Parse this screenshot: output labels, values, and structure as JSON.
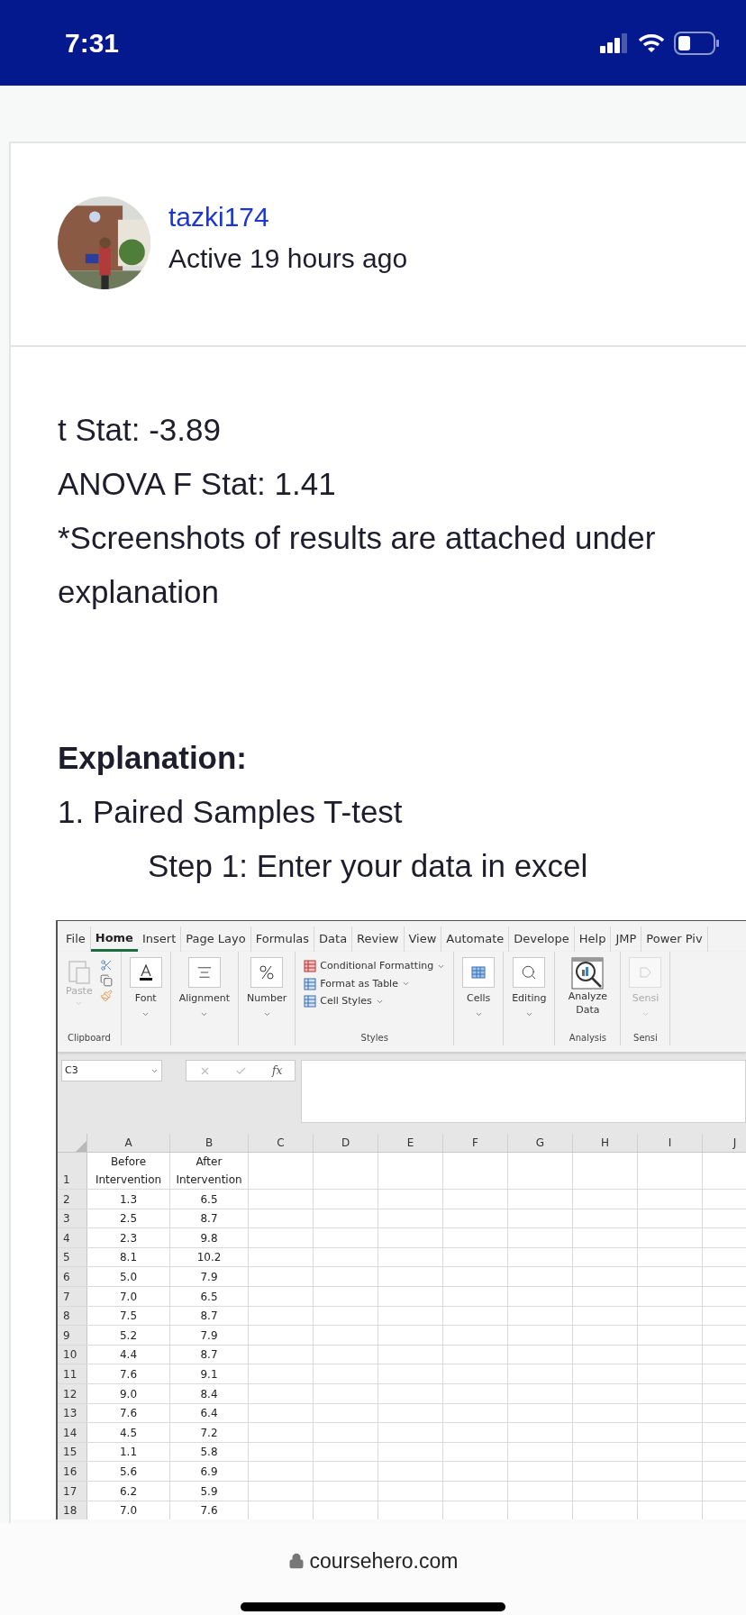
{
  "status_bar": {
    "time": "7:31"
  },
  "author": {
    "username": "tazki174",
    "activity": "Active 19 hours ago"
  },
  "paragraphs": [
    {
      "kind": "plain",
      "text": "t Stat: -3.89"
    },
    {
      "kind": "plain",
      "text": "ANOVA F Stat: 1.41"
    },
    {
      "kind": "plain",
      "text": "*Screenshots of results are attached under explanation"
    },
    {
      "kind": "heading",
      "text": "Explanation:"
    },
    {
      "kind": "plain",
      "text": "1. Paired Samples T-test"
    },
    {
      "kind": "indented",
      "text": "Step 1: Enter your data in excel"
    }
  ],
  "spreadsheet": {
    "tabs": [
      {
        "label": "File",
        "selected": false
      },
      {
        "label": "Home",
        "selected": true
      },
      {
        "label": "Insert",
        "selected": false
      },
      {
        "label": "Page Layo",
        "selected": false
      },
      {
        "label": "Formulas",
        "selected": false
      },
      {
        "label": "Data",
        "selected": false
      },
      {
        "label": "Review",
        "selected": false
      },
      {
        "label": "View",
        "selected": false
      },
      {
        "label": "Automate",
        "selected": false
      },
      {
        "label": "Develope",
        "selected": false
      },
      {
        "label": "Help",
        "selected": false
      },
      {
        "label": "JMP",
        "selected": false
      },
      {
        "label": "Power Piv",
        "selected": false
      }
    ],
    "ribbon": [
      {
        "kind": "clipboard",
        "label": "Paste",
        "disabled": true,
        "footer": "Clipboard"
      },
      {
        "kind": "font",
        "label": "Font"
      },
      {
        "kind": "alignment",
        "label": "Alignment"
      },
      {
        "kind": "number",
        "label": "Number"
      },
      {
        "kind": "styles",
        "items": [
          "Conditional Formatting",
          "Format as Table",
          "Cell Styles"
        ],
        "footer": "Styles"
      },
      {
        "kind": "cells",
        "label": "Cells"
      },
      {
        "kind": "editing",
        "label": "Editing"
      },
      {
        "kind": "analyze",
        "label": "Analyze Data",
        "footer": "Analysis"
      },
      {
        "kind": "sensitivity",
        "label": "Sensi",
        "disabled": true,
        "footer": "Sensi"
      }
    ],
    "name_box": "C3",
    "function_symbol": "fx",
    "columns": [
      "A",
      "B",
      "C",
      "D",
      "E",
      "F",
      "G",
      "H",
      "I",
      "J"
    ],
    "rows": [
      {
        "number": "1",
        "cells": [
          "Before Intervention",
          "After Intervention"
        ]
      },
      {
        "number": "2",
        "cells": [
          "1.3",
          "6.5"
        ]
      },
      {
        "number": "3",
        "cells": [
          "2.5",
          "8.7"
        ]
      },
      {
        "number": "4",
        "cells": [
          "2.3",
          "9.8"
        ]
      },
      {
        "number": "5",
        "cells": [
          "8.1",
          "10.2"
        ]
      },
      {
        "number": "6",
        "cells": [
          "5.0",
          "7.9"
        ]
      },
      {
        "number": "7",
        "cells": [
          "7.0",
          "6.5"
        ]
      },
      {
        "number": "8",
        "cells": [
          "7.5",
          "8.7"
        ]
      },
      {
        "number": "9",
        "cells": [
          "5.2",
          "7.9"
        ]
      },
      {
        "number": "10",
        "cells": [
          "4.4",
          "8.7"
        ]
      },
      {
        "number": "11",
        "cells": [
          "7.6",
          "9.1"
        ]
      },
      {
        "number": "12",
        "cells": [
          "9.0",
          "8.4"
        ]
      },
      {
        "number": "13",
        "cells": [
          "7.6",
          "6.4"
        ]
      },
      {
        "number": "14",
        "cells": [
          "4.5",
          "7.2"
        ]
      },
      {
        "number": "15",
        "cells": [
          "1.1",
          "5.8"
        ]
      },
      {
        "number": "16",
        "cells": [
          "5.6",
          "6.9"
        ]
      },
      {
        "number": "17",
        "cells": [
          "6.2",
          "5.9"
        ]
      },
      {
        "number": "18",
        "cells": [
          "7.0",
          "7.6"
        ]
      }
    ]
  },
  "browser_bar": {
    "url": "coursehero.com"
  }
}
